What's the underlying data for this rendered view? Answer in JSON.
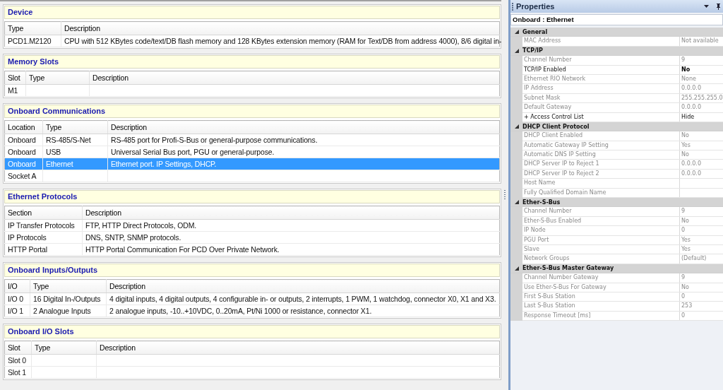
{
  "sections": [
    {
      "title": "Device",
      "columns": [
        "Type",
        "Description"
      ],
      "rows": [
        {
          "cells": [
            "PCD1.M2120",
            "CPU with 512 KBytes code/text/DB flash memory and 128 KBytes extension memory (RAM for Text/DB from address 4000), 8/6 digital in-"
          ],
          "selected": false
        }
      ]
    },
    {
      "title": "Memory Slots",
      "columns": [
        "Slot",
        "Type",
        "Description"
      ],
      "rows": [
        {
          "cells": [
            "M1",
            "",
            ""
          ],
          "selected": false
        }
      ]
    },
    {
      "title": "Onboard Communications",
      "columns": [
        "Location",
        "Type",
        "Description"
      ],
      "rows": [
        {
          "cells": [
            "Onboard",
            "RS-485/S-Net",
            "RS-485 port for Profi-S-Bus or general-purpose communications."
          ],
          "selected": false
        },
        {
          "cells": [
            "Onboard",
            "USB",
            "Universal Serial Bus port, PGU or general-purpose."
          ],
          "selected": false
        },
        {
          "cells": [
            "Onboard",
            "Ethernet",
            "Ethernet port. IP Settings, DHCP."
          ],
          "selected": true
        },
        {
          "cells": [
            "Socket A",
            "",
            ""
          ],
          "selected": false
        }
      ]
    },
    {
      "title": "Ethernet Protocols",
      "columns": [
        "Section",
        "Description"
      ],
      "rows": [
        {
          "cells": [
            "IP Transfer Protocols",
            "FTP, HTTP Direct Protocols, ODM."
          ],
          "selected": false
        },
        {
          "cells": [
            "IP Protocols",
            "DNS, SNTP, SNMP protocols."
          ],
          "selected": false
        },
        {
          "cells": [
            "HTTP Portal",
            "HTTP Portal Communication For PCD Over Private Network."
          ],
          "selected": false
        }
      ]
    },
    {
      "title": "Onboard Inputs/Outputs",
      "columns": [
        "I/O",
        "Type",
        "Description"
      ],
      "rows": [
        {
          "cells": [
            "I/O 0",
            "16 Digital In-/Outputs",
            "4 digital inputs, 4 digital outputs, 4 configurable in- or outputs, 2 interrupts, 1 PWM, 1 watchdog, connector X0, X1 and X3."
          ],
          "selected": false
        },
        {
          "cells": [
            "I/O 1",
            "2 Analogue Inputs",
            "2 analogue inputs, -10..+10VDC, 0..20mA, Pt/Ni 1000 or resistance, connector X1."
          ],
          "selected": false
        }
      ]
    },
    {
      "title": "Onboard I/O Slots",
      "columns": [
        "Slot",
        "Type",
        "Description"
      ],
      "rows": [
        {
          "cells": [
            "Slot 0",
            "",
            ""
          ],
          "selected": false
        },
        {
          "cells": [
            "Slot 1",
            "",
            ""
          ],
          "selected": false
        }
      ]
    }
  ],
  "properties": {
    "title": "Properties",
    "object": "Onboard : Ethernet",
    "categories": [
      {
        "name": "General",
        "expanded": true,
        "rows": [
          {
            "name": "MAC Address",
            "value": "Not available",
            "disabled": true,
            "modified": false
          }
        ]
      },
      {
        "name": "TCP/IP",
        "expanded": true,
        "rows": [
          {
            "name": "Channel Number",
            "value": "9",
            "disabled": true,
            "modified": false
          },
          {
            "name": "TCP/IP Enabled",
            "value": "No",
            "disabled": false,
            "modified": true
          },
          {
            "name": "Ethernet RIO Network",
            "value": "None",
            "disabled": true,
            "modified": false
          },
          {
            "name": "IP Address",
            "value": "0.0.0.0",
            "disabled": true,
            "modified": false
          },
          {
            "name": "Subnet Mask",
            "value": "255.255.255.0",
            "disabled": true,
            "modified": false
          },
          {
            "name": "Default Gateway",
            "value": "0.0.0.0",
            "disabled": true,
            "modified": false
          },
          {
            "name": "+ Access Control List",
            "value": "Hide",
            "disabled": false,
            "modified": false
          }
        ]
      },
      {
        "name": "DHCP Client Protocol",
        "expanded": true,
        "rows": [
          {
            "name": "DHCP Client Enabled",
            "value": "No",
            "disabled": true,
            "modified": false
          },
          {
            "name": "Automatic Gateway IP Setting",
            "value": "Yes",
            "disabled": true,
            "modified": false
          },
          {
            "name": "Automatic DNS IP Setting",
            "value": "No",
            "disabled": true,
            "modified": false
          },
          {
            "name": "DHCP Server IP to Reject 1",
            "value": "0.0.0.0",
            "disabled": true,
            "modified": false
          },
          {
            "name": "DHCP Server IP to Reject 2",
            "value": "0.0.0.0",
            "disabled": true,
            "modified": false
          },
          {
            "name": "Host Name",
            "value": "",
            "disabled": true,
            "modified": false
          },
          {
            "name": "Fully Qualified Domain Name",
            "value": "",
            "disabled": true,
            "modified": false
          }
        ]
      },
      {
        "name": "Ether-S-Bus",
        "expanded": true,
        "rows": [
          {
            "name": "Channel Number",
            "value": "9",
            "disabled": true,
            "modified": false
          },
          {
            "name": "Ether-S-Bus Enabled",
            "value": "No",
            "disabled": true,
            "modified": false
          },
          {
            "name": "IP Node",
            "value": "0",
            "disabled": true,
            "modified": false
          },
          {
            "name": "PGU Port",
            "value": "Yes",
            "disabled": true,
            "modified": false
          },
          {
            "name": "Slave",
            "value": "Yes",
            "disabled": true,
            "modified": false
          },
          {
            "name": "Network Groups",
            "value": "(Default)",
            "disabled": true,
            "modified": false
          }
        ]
      },
      {
        "name": "Ether-S-Bus Master Gateway",
        "expanded": true,
        "rows": [
          {
            "name": "Channel Number Gateway",
            "value": "9",
            "disabled": true,
            "modified": false
          },
          {
            "name": "Use Ether-S-Bus For Gateway",
            "value": "No",
            "disabled": true,
            "modified": false
          },
          {
            "name": "First S-Bus Station",
            "value": "0",
            "disabled": true,
            "modified": false
          },
          {
            "name": "Last S-Bus Station",
            "value": "253",
            "disabled": true,
            "modified": false
          },
          {
            "name": "Response Timeout [ms]",
            "value": "0",
            "disabled": true,
            "modified": false
          }
        ]
      }
    ]
  }
}
